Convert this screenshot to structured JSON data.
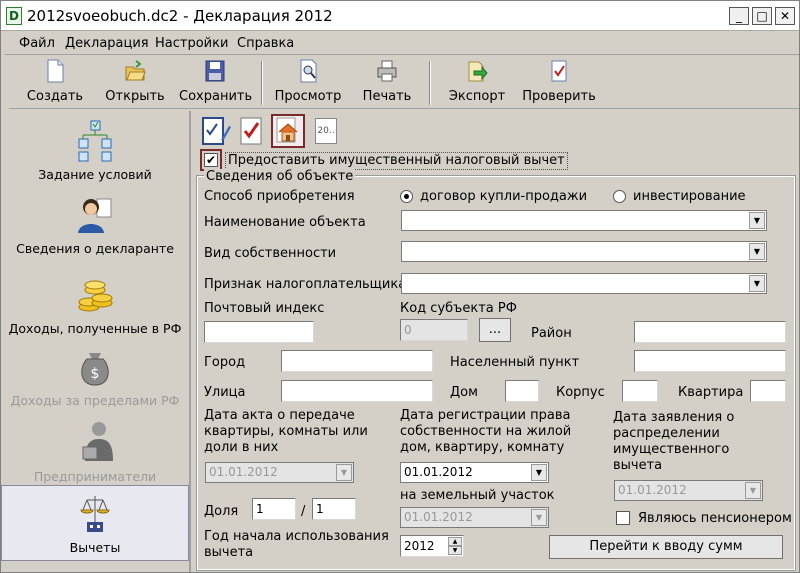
{
  "window": {
    "title": "2012svoeobuch.dc2 - Декларация 2012",
    "app_icon_letter": "D",
    "minimize": "_",
    "maximize": "□",
    "close": "✕"
  },
  "menu": [
    "Файл",
    "Декларация",
    "Настройки",
    "Справка"
  ],
  "toolbar": {
    "create": "Создать",
    "open": "Открыть",
    "save": "Сохранить",
    "preview": "Просмотр",
    "print": "Печать",
    "export": "Экспорт",
    "check": "Проверить"
  },
  "sidebar": {
    "items": [
      {
        "label": "Задание условий",
        "icon": "conditions-tree-icon"
      },
      {
        "label": "Сведения о декларанте",
        "icon": "person-icon"
      },
      {
        "label": "Доходы, полученные в РФ",
        "icon": "coins-icon"
      },
      {
        "label": "Доходы за пределами РФ",
        "icon": "money-bag-icon"
      },
      {
        "label": "Предприниматели",
        "icon": "businessman-icon"
      },
      {
        "label": "Вычеты",
        "icon": "scales-icon"
      }
    ]
  },
  "tabs": {
    "doc_label": "20.."
  },
  "form": {
    "provide_deduction_label": "Предоставить имущественный налоговый вычет",
    "provide_deduction_checked": true,
    "group_title": "Сведения об объекте",
    "acquisition_label": "Способ приобретения",
    "acquisition_opt1": "договор купли-продажи",
    "acquisition_opt2": "инвестирование",
    "object_name_label": "Наименование объекта",
    "ownership_label": "Вид собственности",
    "taxpayer_sign_label": "Признак налогоплательщика",
    "postal_code_label": "Почтовый индекс",
    "region_code_label": "Код субъекта РФ",
    "region_code_value": "0",
    "region_picker": "...",
    "district_label": "Район",
    "city_label": "Город",
    "settlement_label": "Населенный пункт",
    "street_label": "Улица",
    "house_label": "Дом",
    "building_label": "Корпус",
    "apartment_label": "Квартира",
    "transfer_date_label": "Дата акта о передаче квартиры, комнаты или доли в них",
    "transfer_date_value": "01.01.2012",
    "registration_date_label": "Дата регистрации права собственности на жилой дом, квартиру, комнату",
    "registration_date_value": "01.01.2012",
    "land_label": "на земельный участок",
    "land_date_value": "01.01.2012",
    "application_date_label": "Дата заявления о распределении имущественного вычета",
    "application_date_value": "01.01.2012",
    "pensioner_label": "Являюсь пенсионером",
    "share_label": "Доля",
    "share_num": "1",
    "share_sep": "/",
    "share_den": "1",
    "usage_year_label": "Год начала использования вычета",
    "usage_year_value": "2012",
    "go_to_sums_button": "Перейти к вводу сумм"
  }
}
